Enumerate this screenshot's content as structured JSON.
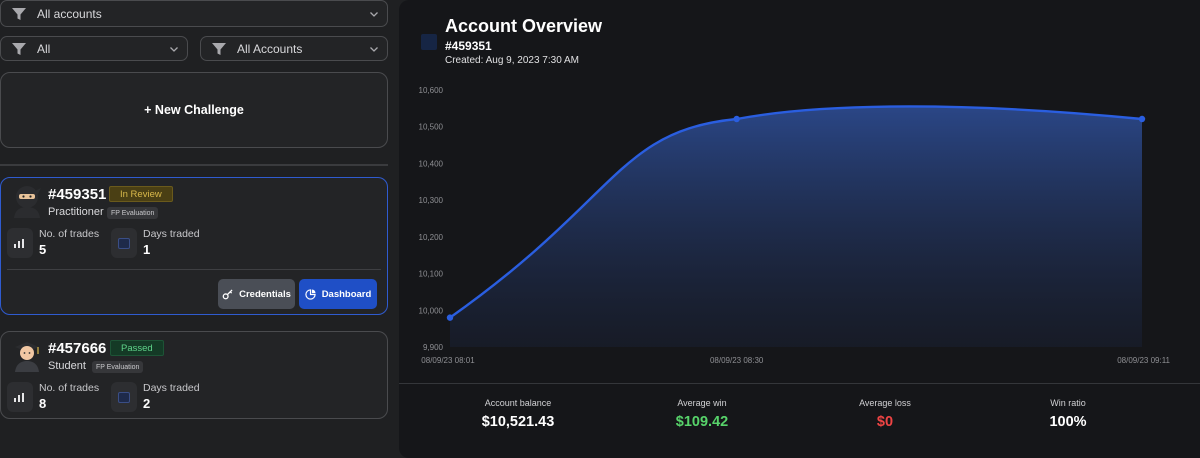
{
  "filters": {
    "top": "All accounts",
    "left": "All",
    "right": "All Accounts"
  },
  "new_challenge": "+ New Challenge",
  "accounts": [
    {
      "id": "#459351",
      "status": "In Review",
      "role": "Practitioner",
      "tag": "FP Evaluation",
      "trades_label": "No. of trades",
      "trades": "5",
      "days_label": "Days traded",
      "days": "1",
      "credentials_label": "Credentials",
      "dashboard_label": "Dashboard"
    },
    {
      "id": "#457666",
      "status": "Passed",
      "role": "Student",
      "tag": "FP Evaluation",
      "trades_label": "No. of trades",
      "trades": "8",
      "days_label": "Days traded",
      "days": "2"
    }
  ],
  "overview": {
    "title": "Account Overview",
    "id": "#459351",
    "created": "Created: Aug 9, 2023 7:30 AM"
  },
  "metrics": [
    {
      "label": "Account balance",
      "value": "$10,521.43",
      "color": "#ffffff"
    },
    {
      "label": "Average win",
      "value": "$109.42",
      "color": "#57d36a"
    },
    {
      "label": "Average loss",
      "value": "$0",
      "color": "#ef4444"
    },
    {
      "label": "Win ratio",
      "value": "100%",
      "color": "#ffffff"
    }
  ],
  "colors": {
    "accent": "#2f5bd0",
    "line": "#2a5ee0"
  },
  "chart_data": {
    "type": "area",
    "x": [
      "08/09/23 08:01",
      "08/09/23 08:30",
      "08/09/23 09:11"
    ],
    "values": [
      9980,
      10521,
      10521
    ],
    "ylim": [
      9900,
      10600
    ],
    "yticks": [
      "9,900",
      "10,000",
      "10,100",
      "10,200",
      "10,300",
      "10,400",
      "10,500",
      "10,600"
    ],
    "grid": false,
    "legend": "none"
  }
}
